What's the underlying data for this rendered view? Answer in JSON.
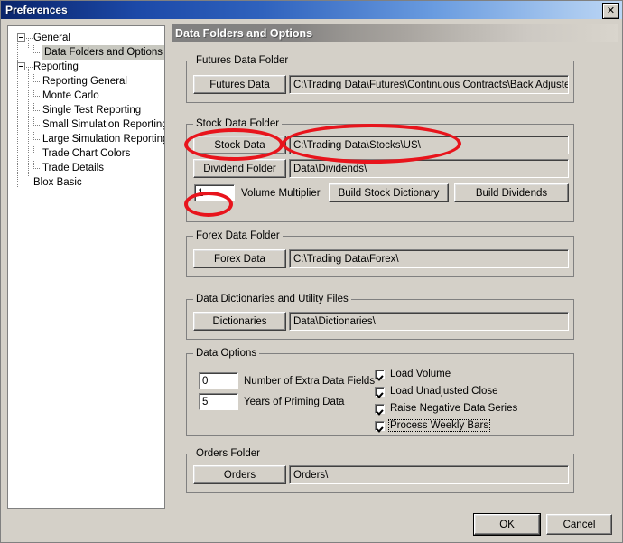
{
  "window": {
    "title": "Preferences",
    "close_label": "✕"
  },
  "sidebar": {
    "items": [
      {
        "label": "General",
        "level": 0,
        "expander": true,
        "selected": false
      },
      {
        "label": "Data Folders and Options",
        "level": 1,
        "expander": false,
        "selected": true
      },
      {
        "label": "Reporting",
        "level": 0,
        "expander": true,
        "selected": false
      },
      {
        "label": "Reporting General",
        "level": 1,
        "expander": false,
        "selected": false
      },
      {
        "label": "Monte Carlo",
        "level": 1,
        "expander": false,
        "selected": false
      },
      {
        "label": "Single Test Reporting",
        "level": 1,
        "expander": false,
        "selected": false
      },
      {
        "label": "Small Simulation Reporting",
        "level": 1,
        "expander": false,
        "selected": false
      },
      {
        "label": "Large Simulation Reporting",
        "level": 1,
        "expander": false,
        "selected": false
      },
      {
        "label": "Trade Chart Colors",
        "level": 1,
        "expander": false,
        "selected": false
      },
      {
        "label": "Trade Details",
        "level": 1,
        "expander": false,
        "selected": false
      },
      {
        "label": "Blox Basic",
        "level": 0,
        "expander": false,
        "selected": false
      }
    ]
  },
  "header": {
    "title": "Data Folders and Options"
  },
  "futures_group": {
    "caption": "Futures Data Folder",
    "button_label": "Futures Data",
    "path_value": "C:\\Trading Data\\Futures\\Continuous Contracts\\Back Adjusted\\"
  },
  "stock_group": {
    "caption": "Stock Data Folder",
    "stock_button_label": "Stock Data",
    "stock_path_value": "C:\\Trading Data\\Stocks\\US\\",
    "dividend_button_label": "Dividend Folder",
    "dividend_path_value": "Data\\Dividends\\",
    "volume_multiplier_value": "1",
    "volume_multiplier_label": "Volume Multiplier",
    "build_stock_dictionary_label": "Build Stock Dictionary",
    "build_dividends_label": "Build Dividends"
  },
  "forex_group": {
    "caption": "Forex Data Folder",
    "button_label": "Forex Data",
    "path_value": "C:\\Trading Data\\Forex\\"
  },
  "dictionaries_group": {
    "caption": "Data Dictionaries and Utility Files",
    "button_label": "Dictionaries",
    "path_value": "Data\\Dictionaries\\"
  },
  "data_options_group": {
    "caption": "Data Options",
    "extra_fields_value": "0",
    "extra_fields_label": "Number of Extra Data Fields",
    "priming_years_value": "5",
    "priming_years_label": "Years of Priming Data",
    "checkboxes": [
      {
        "label": "Load Volume",
        "checked": true,
        "focused": false
      },
      {
        "label": "Load Unadjusted Close",
        "checked": true,
        "focused": false
      },
      {
        "label": "Raise Negative Data Series",
        "checked": true,
        "focused": false
      },
      {
        "label": "Process Weekly Bars",
        "checked": true,
        "focused": true
      }
    ]
  },
  "orders_group": {
    "caption": "Orders Folder",
    "button_label": "Orders",
    "path_value": "Orders\\"
  },
  "footer": {
    "ok_label": "OK",
    "cancel_label": "Cancel"
  },
  "annotations": {
    "accent_color": "#e8141c",
    "circles": [
      {
        "name": "stock-data-button-highlight"
      },
      {
        "name": "stock-data-path-highlight"
      },
      {
        "name": "volume-multiplier-highlight"
      }
    ]
  }
}
